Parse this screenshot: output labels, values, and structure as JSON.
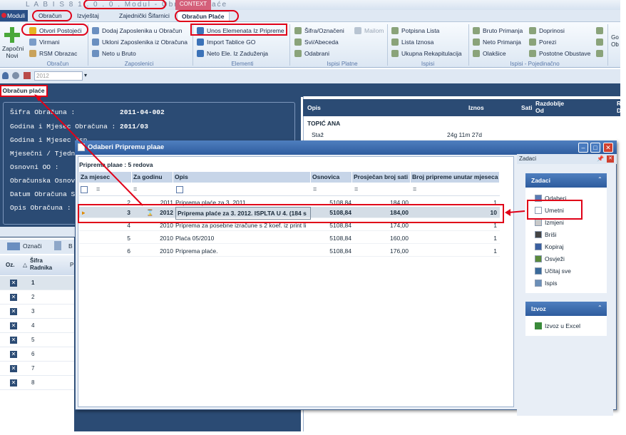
{
  "window": {
    "title": "L A B I S  8 1 . 0 . 0 .  Modul - Obračun Plaće",
    "context_tab": "CONTEXT"
  },
  "menu": {
    "modules": "Moduli",
    "tabs": [
      "Obračun",
      "Izvještaj",
      "Zajednički Šifarnici",
      "Obračun Plaće"
    ]
  },
  "ribbon": {
    "new": "Započni Novi",
    "obracun": [
      "Otvori Postojeći",
      "Virmani",
      "RSM Obrazac"
    ],
    "zaposlenici": [
      "Dodaj Zaposlenika u Obračun",
      "Ukloni Zaposlenika iz Obračuna",
      "Neto u Bruto"
    ],
    "elementi": [
      "Unos Elemenata Iz Pripreme",
      "Import Tablice GO",
      "Neto Ele. Iz Zaduženja"
    ],
    "platne": [
      "Šifra/Označeni",
      "Mailom",
      "Svi/Abeceda",
      "Odabrani"
    ],
    "ispisi": [
      "Potpisna Lista",
      "Lista Iznosa",
      "Ukupna Rekapitulacija"
    ],
    "pojedinacno_a": [
      "Bruto Primanja",
      "Neto Primanja",
      "Olakšice"
    ],
    "pojedinacno_b": [
      "Doprinosi",
      "Porezi",
      "Postotne Obustave"
    ],
    "more": "Go Ob",
    "groups": [
      "Obračun",
      "Zaposlenici",
      "Elementi",
      "Ispisi Platne",
      "Ispisi",
      "Ispisi - Pojedinačno"
    ]
  },
  "toolbar": {
    "year_value": "2012"
  },
  "page_tab": "Obračun plaće",
  "form": {
    "fields": [
      {
        "label": "Šifra Obračuna :",
        "value": "2011-04-002"
      },
      {
        "label": "Godina i Mjesec Obračuna :",
        "value": "2011/03"
      },
      {
        "label": "Godina i Mjesec Isp",
        "value": ""
      },
      {
        "label": "Mjesečni / Tjedni Fo",
        "value": ""
      },
      {
        "label": "Osnovni OO :",
        "value": ""
      },
      {
        "label": "Obračunska Osnovi",
        "value": ""
      },
      {
        "label": "Datum Obračuna St",
        "value": ""
      },
      {
        "label": "Opis Obračuna :",
        "value": ""
      }
    ]
  },
  "employees": {
    "toolbar": "Označi",
    "toolbar2": "B",
    "headers": [
      "Oz.",
      "Šifra Radnika",
      "P"
    ],
    "rows": [
      "1",
      "2",
      "3",
      "4",
      "5",
      "6",
      "7",
      "8"
    ]
  },
  "right_panel": {
    "headers": [
      "Opis",
      "Iznos",
      "Sati",
      "Razdoblje Od",
      "R D"
    ],
    "group": "TOPIĆ ANA",
    "rows": [
      {
        "opis": "Staž",
        "value": "24g 11m 27d"
      }
    ]
  },
  "dialog": {
    "title": "Odaberi Pripremu plaae",
    "count": "Priprema plaae : 5 redova",
    "headers": [
      "Za mjesec",
      "Za godinu",
      "Opis",
      "Osnovica",
      "Prosječan broj sati",
      "Broj pripreme unutar mjeseca"
    ],
    "rows": [
      {
        "m": "2",
        "y": "2011",
        "opis": "Priprema plaće za 3. 2011.",
        "osn": "5108,84",
        "sati": "184,00",
        "br": "1"
      },
      {
        "m": "3",
        "y": "2012",
        "opis": "Priprema plaće za 3. 2012. ISPLTA U 4. (184 s",
        "osn": "5108,84",
        "sati": "184,00",
        "br": "10"
      },
      {
        "m": "4",
        "y": "2010",
        "opis": "Priprema za posebne izračune s 2 koef. iz print li",
        "osn": "5108,84",
        "sati": "174,00",
        "br": "1"
      },
      {
        "m": "5",
        "y": "2010",
        "opis": "Plaća 05/2010",
        "osn": "5108,84",
        "sati": "160,00",
        "br": "1"
      },
      {
        "m": "6",
        "y": "2010",
        "opis": "Priprema plaće.",
        "osn": "5108,84",
        "sati": "176,00",
        "br": "1"
      }
    ]
  },
  "tasks": {
    "pane": "Zadaci",
    "header": "Zadaci",
    "items": [
      "Odaberi",
      "Umetni",
      "Izmjeni",
      "Briši",
      "Kopiraj",
      "Osvježi",
      "Učitaj sve",
      "Ispis"
    ],
    "export_header": "Izvoz",
    "export_items": [
      "Izvoz u Excel"
    ]
  },
  "colors": {
    "accent_red": "#e00018",
    "navy": "#2b4b74",
    "header_blue": "#2e5c9e"
  }
}
